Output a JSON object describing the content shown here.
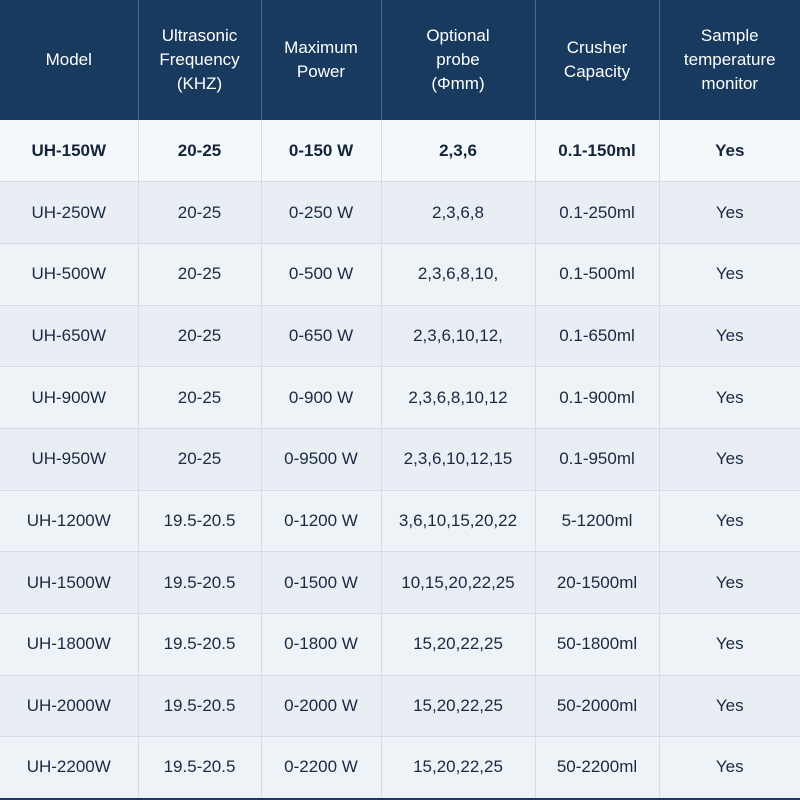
{
  "table": {
    "headers": [
      [
        "Model"
      ],
      [
        "Ultrasonic",
        "Frequency",
        "(KHZ)"
      ],
      [
        "Maximum",
        "Power"
      ],
      [
        "Optional",
        "probe",
        "(Φmm)"
      ],
      [
        "Crusher",
        "Capacity"
      ],
      [
        "Sample",
        "temperature",
        "monitor"
      ]
    ],
    "rows": [
      [
        "UH-150W",
        "20-25",
        "0-150 W",
        "2,3,6",
        "0.1-150ml",
        "Yes"
      ],
      [
        "UH-250W",
        "20-25",
        "0-250 W",
        "2,3,6,8",
        "0.1-250ml",
        "Yes"
      ],
      [
        "UH-500W",
        "20-25",
        "0-500 W",
        "2,3,6,8,10,",
        "0.1-500ml",
        "Yes"
      ],
      [
        "UH-650W",
        "20-25",
        "0-650 W",
        "2,3,6,10,12,",
        "0.1-650ml",
        "Yes"
      ],
      [
        "UH-900W",
        "20-25",
        "0-900 W",
        "2,3,6,8,10,12",
        "0.1-900ml",
        "Yes"
      ],
      [
        "UH-950W",
        "20-25",
        "0-9500 W",
        "2,3,6,10,12,15",
        "0.1-950ml",
        "Yes"
      ],
      [
        "UH-1200W",
        "19.5-20.5",
        "0-1200 W",
        "3,6,10,15,20,22",
        "5-1200ml",
        "Yes"
      ],
      [
        "UH-1500W",
        "19.5-20.5",
        "0-1500 W",
        "10,15,20,22,25",
        "20-1500ml",
        "Yes"
      ],
      [
        "UH-1800W",
        "19.5-20.5",
        "0-1800 W",
        "15,20,22,25",
        "50-1800ml",
        "Yes"
      ],
      [
        "UH-2000W",
        "19.5-20.5",
        "0-2000 W",
        "15,20,22,25",
        "50-2000ml",
        "Yes"
      ],
      [
        "UH-2200W",
        "19.5-20.5",
        "0-2200 W",
        "15,20,22,25",
        "50-2200ml",
        "Yes"
      ]
    ],
    "highlight_row": 0
  },
  "colors": {
    "header_bg": "#183a5f",
    "header_text": "#ffffff",
    "row_text": "#1a2a40"
  }
}
